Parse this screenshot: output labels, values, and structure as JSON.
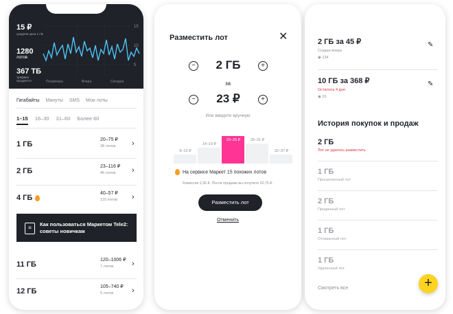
{
  "market": {
    "stats": {
      "price": "15 ₽",
      "price_caption": "средняя цена 1 ГБ",
      "lots": "1280",
      "lots_caption": "лотов",
      "traffic": "367 ТБ",
      "traffic_caption": "трафика продаётся"
    },
    "chart": {
      "y_ticks": [
        "15",
        "10",
        "5"
      ],
      "x_labels": [
        "Позавчера",
        "Вчера",
        "Сегодня"
      ]
    },
    "tabs": [
      "Гигабайты",
      "Минуты",
      "SMS",
      "Мои лоты"
    ],
    "ranges": [
      "1–15",
      "16–30",
      "31–60",
      "Более 60"
    ],
    "rows": [
      {
        "volume": "1 ГБ",
        "price": "20–75 ₽",
        "lots": "38 лотов",
        "hot": false
      },
      {
        "volume": "2 ГБ",
        "price": "23–116 ₽",
        "lots": "46 лотов",
        "hot": false
      },
      {
        "volume": "4 ГБ",
        "price": "40–57 ₽",
        "lots": "110 лотов",
        "hot": true
      }
    ],
    "banner": "Как пользоваться Маркетом Tele2: советы новичкам",
    "rows_after": [
      {
        "volume": "11 ГБ",
        "price": "120–1006 ₽",
        "lots": "7 лотов"
      },
      {
        "volume": "12 ГБ",
        "price": "105–740 ₽",
        "lots": "5 лотов"
      }
    ]
  },
  "modal": {
    "title": "Разместить лот",
    "amount": "2 ГБ",
    "for": "за",
    "price": "23 ₽",
    "manual_hint": "Или введите вручную",
    "distribution": [
      {
        "label": "8–13 ₽",
        "level": 0.33,
        "highlight": false
      },
      {
        "label": "14–19 ₽",
        "level": 0.58,
        "highlight": false
      },
      {
        "label": "20–25 ₽",
        "level": 1.0,
        "highlight": true
      },
      {
        "label": "26–31 ₽",
        "level": 0.73,
        "highlight": false
      },
      {
        "label": "32–37 ₽",
        "level": 0.33,
        "highlight": false
      }
    ],
    "similar": "На сервисе Маркет 15 похожих лотов",
    "fee": "Комиссия 2,30 ₽. После продажи вы получите 20,70 ₽.",
    "submit": "Разместить лот",
    "cancel": "Отменить"
  },
  "my_lots": {
    "active": [
      {
        "title": "2 ГБ за 45 ₽",
        "sub": "Создан вчера",
        "views": "134",
        "warn": false
      },
      {
        "title": "10 ГБ за 368 ₽",
        "sub": "Осталось 4 дня",
        "views": "15",
        "warn": true
      }
    ],
    "history_title": "История покупок и продаж",
    "history": [
      {
        "title": "2 ГБ",
        "sub": "Лот не удалось разместить",
        "dim": false,
        "warn": true
      },
      {
        "title": "1 ГБ",
        "sub": "Просроченный лот",
        "dim": true,
        "warn": false
      },
      {
        "title": "2 ГБ",
        "sub": "Проданный лот",
        "dim": true,
        "warn": false
      },
      {
        "title": "1 ГБ",
        "sub": "Отозванный лот",
        "dim": true,
        "warn": false
      },
      {
        "title": "1 ГБ",
        "sub": "Удаленный лот",
        "dim": true,
        "warn": false
      }
    ],
    "show_all": "Смотреть все"
  },
  "colors": {
    "dark": "#1f2229",
    "accent_pink": "#ff3495",
    "accent_yellow": "#ffd31f",
    "warn_red": "#e02e3c",
    "fire": "#f79c25"
  }
}
